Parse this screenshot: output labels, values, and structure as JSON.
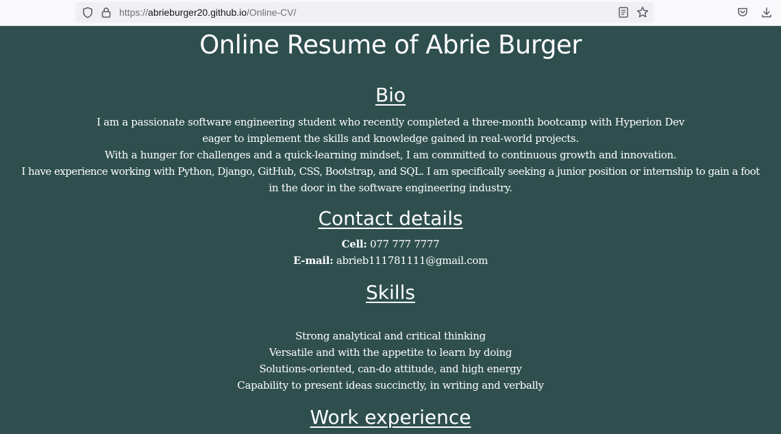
{
  "browser": {
    "url_scheme": "https://",
    "url_host": "abrieburger20.github.io",
    "url_path": "/Online-CV/",
    "icons": {
      "shield": "shield-icon",
      "lock": "lock-icon",
      "reader": "reader-view-icon",
      "bookmark": "star-icon",
      "pocket": "pocket-icon",
      "downloads": "download-icon"
    }
  },
  "page": {
    "title": "Online Resume of Abrie Burger",
    "background_color": "#2f4f4f",
    "bio": {
      "heading": "Bio",
      "lines": [
        "I am a passionate software engineering student who recently completed a three-month bootcamp with Hyperion Dev",
        "eager to implement the skills and knowledge gained in real-world projects.",
        "With a hunger for challenges and a quick-learning mindset, I am committed to continuous growth and innovation.",
        "I have experience working with Python, Django, GitHub, CSS, Bootstrap, and SQL. I am specifically seeking a junior position or internship to gain a foot",
        "in the door in the software engineering industry."
      ]
    },
    "contact": {
      "heading": "Contact details",
      "cell_label": "Cell:",
      "cell_value": "077 777 7777",
      "email_label": "E-mail:",
      "email_value": "abrieb111781111@gmail.com"
    },
    "skills": {
      "heading": "Skills",
      "items": [
        "Strong analytical and critical thinking",
        "Versatile and with the appetite to learn by doing",
        "Solutions-oriented, can-do attitude, and high energy",
        "Capability to present ideas succinctly, in writing and verbally"
      ]
    },
    "work": {
      "heading": "Work experience"
    }
  }
}
